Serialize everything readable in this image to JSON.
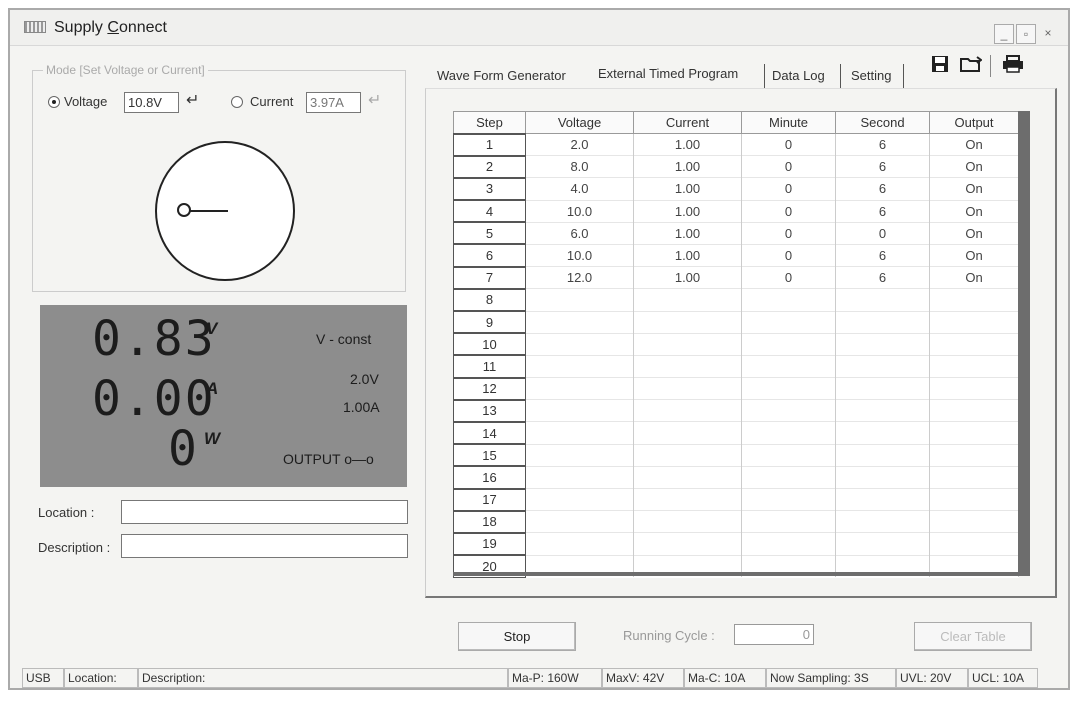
{
  "window": {
    "title_pre": "Supply ",
    "title_ul": "C",
    "title_post": "onnect",
    "controls": [
      "_",
      "▫",
      "×"
    ]
  },
  "mode_group": {
    "legend": "Mode [Set Voltage or Current]",
    "voltage_label": "Voltage",
    "voltage_value": "10.8V",
    "voltage_selected": true,
    "current_label": "Current",
    "current_value": "3.97A",
    "current_selected": false
  },
  "display": {
    "voltage": "0.83",
    "voltage_unit": "V",
    "current": "0.00",
    "current_unit": "A",
    "power": "0",
    "power_unit": "W",
    "mode": "V - const",
    "set_voltage": "2.0V",
    "set_current": "1.00A",
    "output": "OUTPUT o—o"
  },
  "location_label": "Location :",
  "description_label": "Description :",
  "tabs": [
    {
      "label": "Wave Form Generator",
      "active": false
    },
    {
      "label": "External Timed Program",
      "active": true
    },
    {
      "label": "Data Log",
      "active": false
    },
    {
      "label": "Setting",
      "active": false
    }
  ],
  "toolbar_icons": [
    "save-icon",
    "open-folder-icon",
    "print-icon"
  ],
  "table": {
    "headers": [
      "Step",
      "Voltage",
      "Current",
      "Minute",
      "Second",
      "Output"
    ],
    "rows": [
      [
        "1",
        "2.0",
        "1.00",
        "0",
        "6",
        "On"
      ],
      [
        "2",
        "8.0",
        "1.00",
        "0",
        "6",
        "On"
      ],
      [
        "3",
        "4.0",
        "1.00",
        "0",
        "6",
        "On"
      ],
      [
        "4",
        "10.0",
        "1.00",
        "0",
        "6",
        "On"
      ],
      [
        "5",
        "6.0",
        "1.00",
        "0",
        "0",
        "On"
      ],
      [
        "6",
        "10.0",
        "1.00",
        "0",
        "6",
        "On"
      ],
      [
        "7",
        "12.0",
        "1.00",
        "0",
        "6",
        "On"
      ],
      [
        "8",
        "",
        "",
        "",
        "",
        ""
      ],
      [
        "9",
        "",
        "",
        "",
        "",
        ""
      ],
      [
        "10",
        "",
        "",
        "",
        "",
        ""
      ],
      [
        "11",
        "",
        "",
        "",
        "",
        ""
      ],
      [
        "12",
        "",
        "",
        "",
        "",
        ""
      ],
      [
        "13",
        "",
        "",
        "",
        "",
        ""
      ],
      [
        "14",
        "",
        "",
        "",
        "",
        ""
      ],
      [
        "15",
        "",
        "",
        "",
        "",
        ""
      ],
      [
        "16",
        "",
        "",
        "",
        "",
        ""
      ],
      [
        "17",
        "",
        "",
        "",
        "",
        ""
      ],
      [
        "18",
        "",
        "",
        "",
        "",
        ""
      ],
      [
        "19",
        "",
        "",
        "",
        "",
        ""
      ],
      [
        "20",
        "",
        "",
        "",
        "",
        ""
      ]
    ]
  },
  "stop_label": "Stop",
  "running_cycle_label": "Running Cycle :",
  "running_cycle_value": "0",
  "clear_table_label": "Clear Table",
  "status": {
    "usb": "USB",
    "location": "Location:",
    "description": "Description:",
    "max_p": "Ma-P: 160W",
    "max_v": "MaxV: 42V",
    "max_c": "Ma-C: 10A",
    "sampling": "Now Sampling: 3S",
    "uvl": "UVL: 20V",
    "ucl": "UCL: 10A"
  }
}
